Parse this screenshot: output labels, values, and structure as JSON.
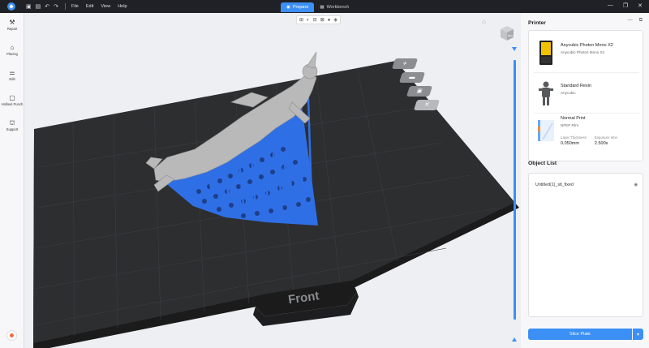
{
  "titlebar": {
    "menus": [
      "File",
      "Edit",
      "View",
      "Help"
    ],
    "tabs": [
      {
        "label": "Prepare",
        "active": true
      },
      {
        "label": "Workbench",
        "active": false
      }
    ],
    "window_controls": [
      "minimize-icon",
      "restore-icon",
      "close-icon"
    ]
  },
  "left_toolbar": {
    "items": [
      {
        "label": "Repair",
        "icon": "wrench-icon"
      },
      {
        "label": "Placing",
        "icon": "placing-icon"
      },
      {
        "label": "Edit",
        "icon": "sliders-icon"
      },
      {
        "label": "Hollow\\ Punch",
        "icon": "hollow-icon"
      },
      {
        "label": "Support",
        "icon": "support-icon"
      }
    ]
  },
  "viewport": {
    "plate_label": "Front",
    "cube_label": "RIGHT",
    "accent": "#3b8ff5",
    "support_color": "#2f6fe6",
    "model_color": "#b9b9b9"
  },
  "printer": {
    "section_title": "Printer",
    "machine": {
      "name": "Anycubic Photon Mono X2",
      "sub": "Anycubic Photon Mono X2"
    },
    "resin": {
      "name": "Standard Resin",
      "sub": "Anycubic"
    },
    "profile": {
      "name": "Normal Print",
      "sub": "NFEP Film",
      "layer_thickness_label": "Layer Thickness",
      "layer_thickness_value": "0.050mm",
      "exposure_label": "Exposure time",
      "exposure_value": "2.500s"
    }
  },
  "object_list": {
    "title": "Object List",
    "items": [
      {
        "name": "Untitled(1)_stl_fixed"
      }
    ]
  },
  "slice_button": {
    "label": "Slice Plate"
  }
}
